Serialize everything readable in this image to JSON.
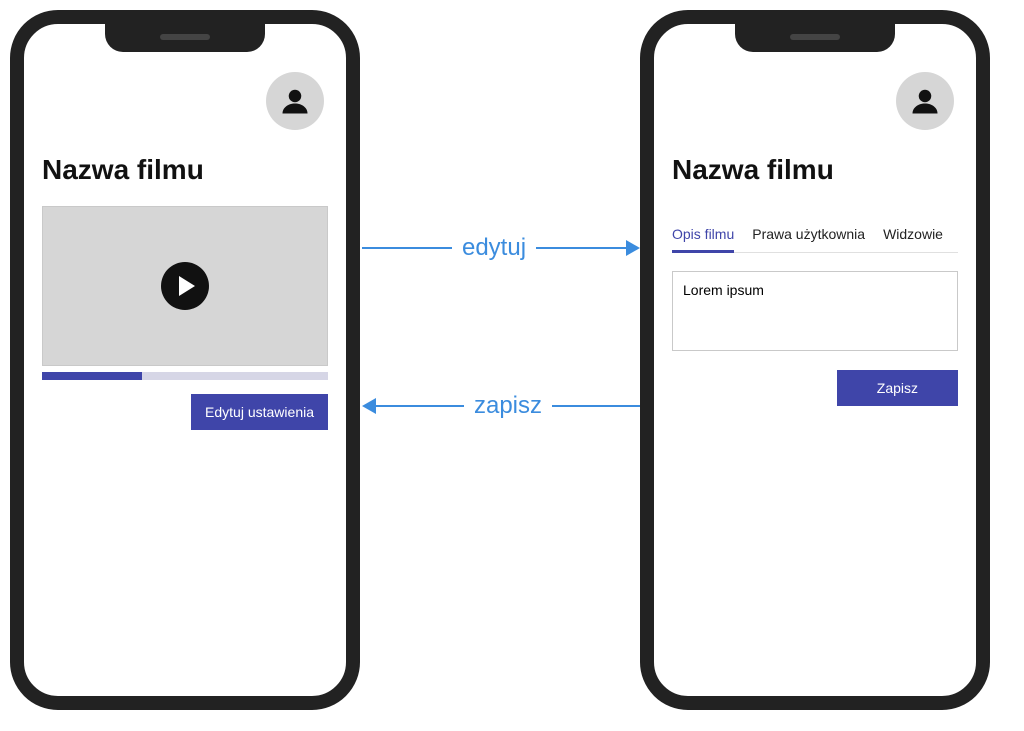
{
  "left": {
    "title": "Nazwa filmu",
    "edit_button": "Edytuj ustawienia"
  },
  "right": {
    "title": "Nazwa filmu",
    "tabs": {
      "desc": "Opis filmu",
      "rights": "Prawa użytkownia",
      "viewers": "Widzowie"
    },
    "textarea_value": "Lorem ipsum",
    "save_button": "Zapisz"
  },
  "flow": {
    "edit": "edytuj",
    "save": "zapisz"
  }
}
